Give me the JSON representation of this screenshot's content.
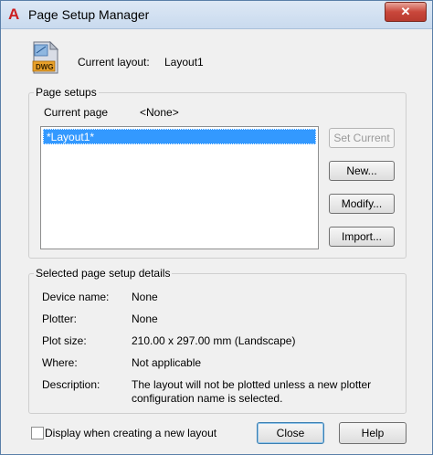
{
  "window": {
    "title": "Page Setup Manager",
    "close_glyph": "✕",
    "app_icon": "autocad-a-icon",
    "app_glyph": "A"
  },
  "current_layout": {
    "icon": "dwg-file-icon",
    "icon_text": "DWG",
    "label": "Current layout:",
    "value": "Layout1"
  },
  "page_setups": {
    "group_title": "Page setups",
    "current_page_label": "Current page",
    "current_page_value": "<None>",
    "items": [
      "*Layout1*"
    ],
    "selected_index": 0,
    "buttons": {
      "set_current": "Set Current",
      "new": "New...",
      "modify": "Modify...",
      "import": "Import..."
    }
  },
  "details": {
    "group_title": "Selected page setup details",
    "rows": [
      {
        "label": "Device name:",
        "value": "None"
      },
      {
        "label": "Plotter:",
        "value": "None"
      },
      {
        "label": "Plot size:",
        "value": "210.00 x 297.00 mm (Landscape)"
      },
      {
        "label": "Where:",
        "value": "Not applicable"
      },
      {
        "label": "Description:",
        "value": "The layout will not be plotted unless a new plotter",
        "value2": "configuration name is selected."
      }
    ]
  },
  "footer": {
    "checkbox_label": "Display when creating a new layout",
    "checkbox_checked": false,
    "close_label": "Close",
    "help_label": "Help"
  }
}
